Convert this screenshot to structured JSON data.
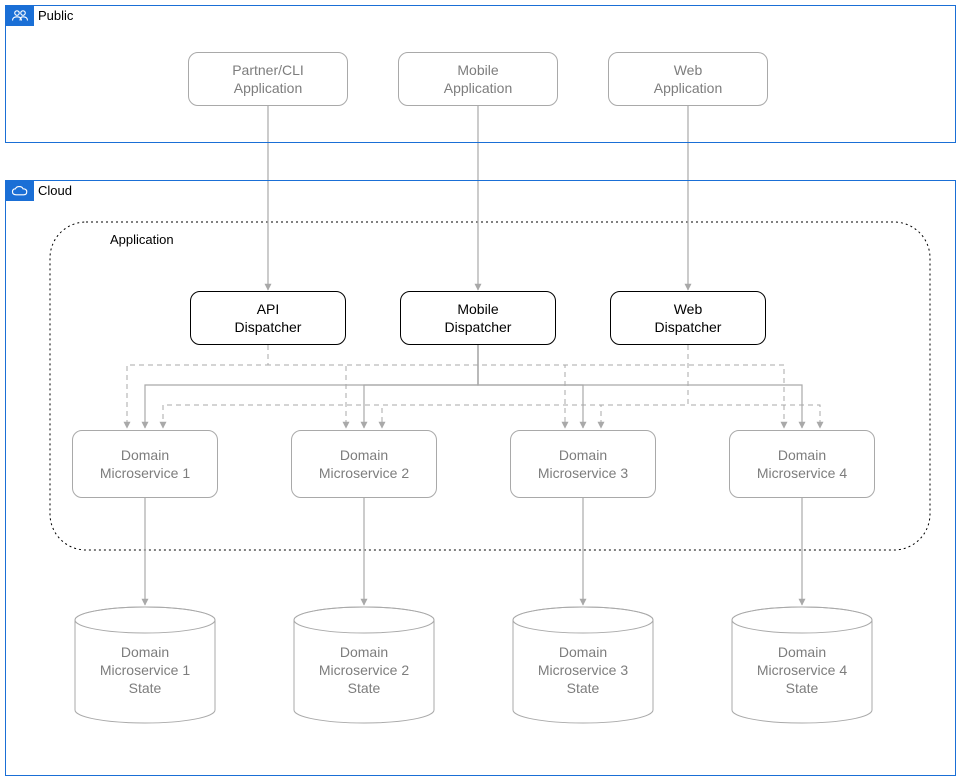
{
  "zones": {
    "public": {
      "title": "Public",
      "icon": "public-icon"
    },
    "cloud": {
      "title": "Cloud",
      "icon": "cloud-icon"
    },
    "application": {
      "title": "Application"
    }
  },
  "clients": {
    "partner": "Partner/CLI\nApplication",
    "mobile": "Mobile\nApplication",
    "web": "Web\nApplication"
  },
  "dispatchers": {
    "api": "API\nDispatcher",
    "mobile": "Mobile\nDispatcher",
    "web": "Web\nDispatcher"
  },
  "microservices": [
    {
      "name": "Domain\nMicroservice 1",
      "state": "Domain\nMicroservice 1\nState"
    },
    {
      "name": "Domain\nMicroservice 2",
      "state": "Domain\nMicroservice 2\nState"
    },
    {
      "name": "Domain\nMicroservice 3",
      "state": "Domain\nMicroservice 3\nState"
    },
    {
      "name": "Domain\nMicroservice 4",
      "state": "Domain\nMicroservice 4\nState"
    }
  ],
  "colors": {
    "frame_border": "#1a6fd6",
    "light_stroke": "#a9a9a9",
    "dark_stroke": "#000000",
    "muted_text": "#7d7d7d"
  }
}
